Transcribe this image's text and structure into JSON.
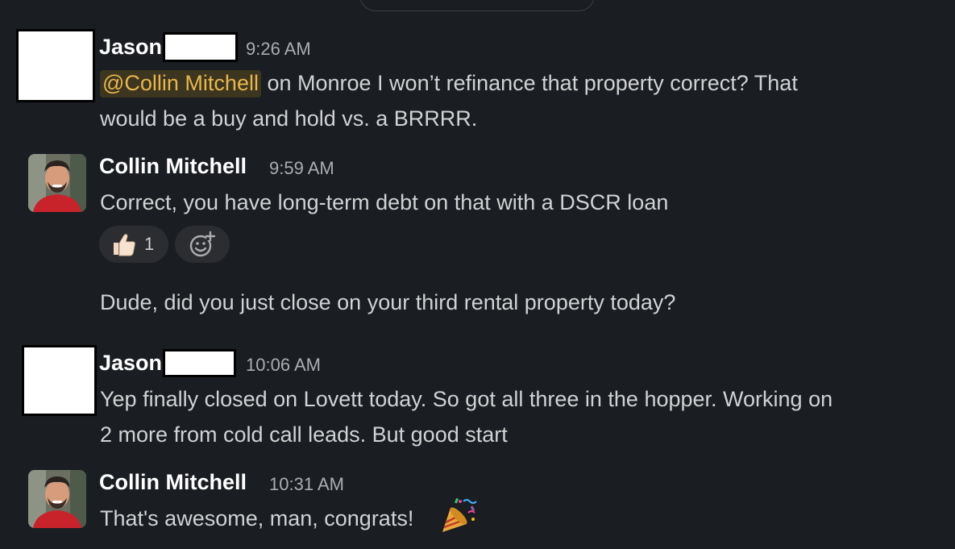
{
  "messages": [
    {
      "author_first": "Jason",
      "author_last_redacted": true,
      "time": "9:26 AM",
      "mention": "@Collin Mitchell",
      "text_line1": " on Monroe I won’t refinance that property correct? That",
      "text_line2": "would be a buy and hold vs. a BRRRR."
    },
    {
      "author": "Collin Mitchell",
      "time": "9:59 AM",
      "text": "Correct, you have long-term debt on that with a DSCR loan",
      "reaction": {
        "emoji": "thumbs-up",
        "count": "1"
      }
    },
    {
      "author": "Collin Mitchell",
      "continued": true,
      "text": "Dude, did you just close on your third rental property today?"
    },
    {
      "author_first": "Jason",
      "author_last_redacted": true,
      "time": "10:06 AM",
      "text_line1": "Yep finally closed on Lovett today. So got all three in the hopper. Working on",
      "text_line2": "2 more from cold call leads. But good start"
    },
    {
      "author": "Collin Mitchell",
      "time": "10:31 AM",
      "text": "That's awesome, man, congrats!",
      "emoji": "party-popper"
    }
  ],
  "colors": {
    "background": "#1a1d21",
    "mention_bg": "#3c3620",
    "mention_text": "#e8b64c",
    "reaction_bg": "#2b2d31"
  }
}
